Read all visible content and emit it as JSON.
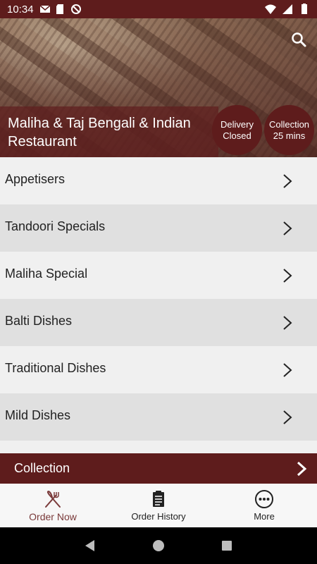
{
  "status_bar": {
    "time": "10:34"
  },
  "hero": {
    "restaurant_name": "Maliha & Taj Bengali & Indian Restaurant",
    "delivery": {
      "line1": "Delivery",
      "line2": "Closed"
    },
    "collection": {
      "line1": "Collection",
      "line2": "25 mins"
    }
  },
  "menu": {
    "items": [
      {
        "label": "Appetisers"
      },
      {
        "label": "Tandoori Specials"
      },
      {
        "label": "Maliha Special"
      },
      {
        "label": "Balti Dishes"
      },
      {
        "label": "Traditional Dishes"
      },
      {
        "label": "Mild Dishes"
      },
      {
        "label": ""
      }
    ]
  },
  "collection_bar": {
    "label": "Collection"
  },
  "bottom_nav": {
    "items": [
      {
        "label": "Order Now",
        "icon": "fork-knife-icon"
      },
      {
        "label": "Order History",
        "icon": "clipboard-icon"
      },
      {
        "label": "More",
        "icon": "more-dots-icon"
      }
    ]
  },
  "colors": {
    "brand": "#5e1c1c",
    "active_nav": "#7a3a3a"
  }
}
